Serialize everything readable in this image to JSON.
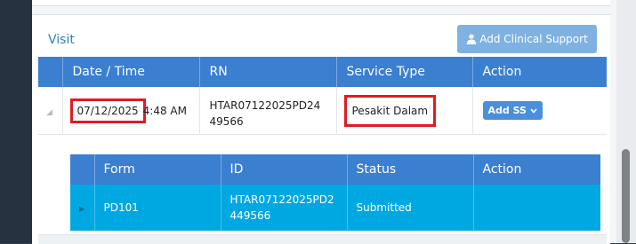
{
  "panel": {
    "title": "Visit",
    "add_clinical_support_label": "Add Clinical Support"
  },
  "visits_table": {
    "columns": [
      "Date / Time",
      "RN",
      "Service Type",
      "Action"
    ],
    "rows": [
      {
        "date": "07/12/2025",
        "time": "4:48 AM",
        "rn": "HTAR07122025PD2449566",
        "service_type": "Pesakit Dalam",
        "action_label": "Add SS"
      }
    ]
  },
  "forms_table": {
    "columns": [
      "Form",
      "ID",
      "Status",
      "Action"
    ],
    "rows": [
      {
        "form": "PD101",
        "id": "HTAR07122025PD2449566",
        "status": "Submitted"
      }
    ]
  },
  "icons": {
    "add_clinical_support": "user-doctor-icon",
    "add_ss_dropdown": "chevron-down-icon",
    "row_expander": "triangle-icon",
    "sub_row_expander": "play-icon"
  },
  "colors": {
    "header_blue": "#3a7fd0",
    "selected_row_cyan": "#00a8e1",
    "title_link_blue": "#2f7fc1",
    "button_blue": "#7fb1e3",
    "highlight_red": "#e11b22"
  }
}
